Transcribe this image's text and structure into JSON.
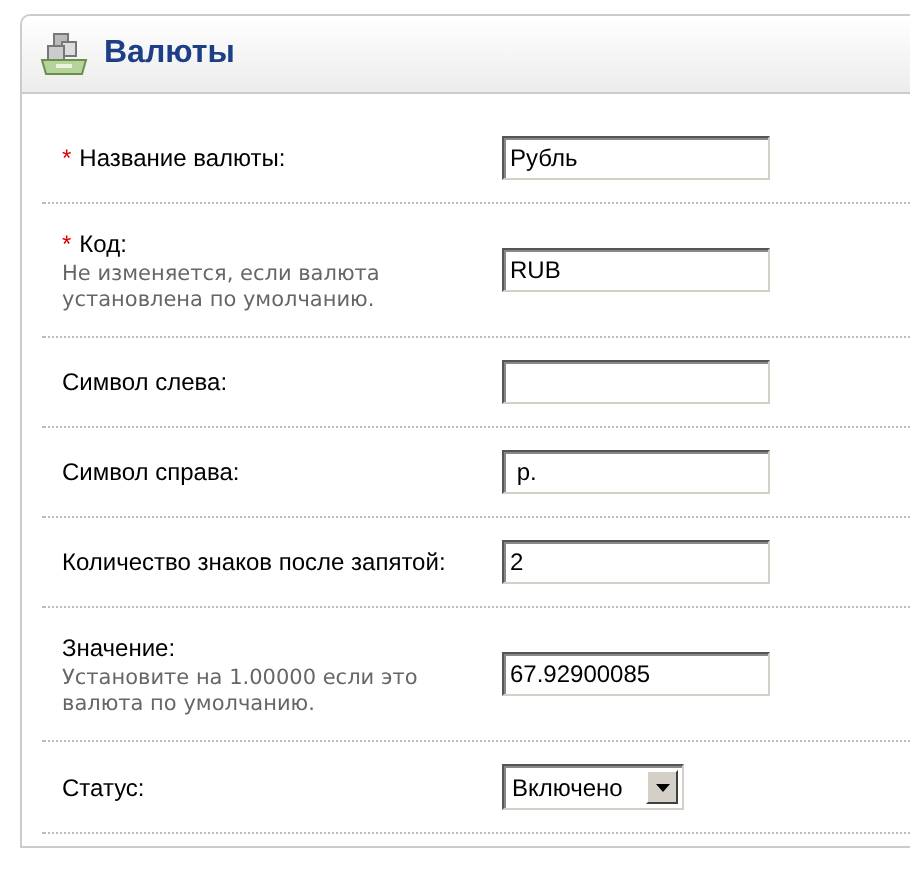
{
  "panel": {
    "title": "Валюты"
  },
  "fields": [
    {
      "kind": "text",
      "marker": "*",
      "label": "Название валюты:",
      "value": "Рубль"
    },
    {
      "kind": "text",
      "marker": "*",
      "label": "Код:",
      "hint": "Не изменяется, если валюта установлена по умолчанию.",
      "value": "RUB"
    },
    {
      "kind": "text",
      "label": "Символ слева:"
    },
    {
      "kind": "text",
      "label": "Символ справа:",
      "value": " р."
    },
    {
      "kind": "text",
      "label": "Количество знаков после запятой:",
      "value": "2"
    },
    {
      "kind": "text",
      "label": "Значение:",
      "hint": "Установите на 1.00000 если это валюта по умолчанию.",
      "value": "67.92900085"
    },
    {
      "kind": "select",
      "label": "Статус:",
      "value": "Включено"
    }
  ]
}
